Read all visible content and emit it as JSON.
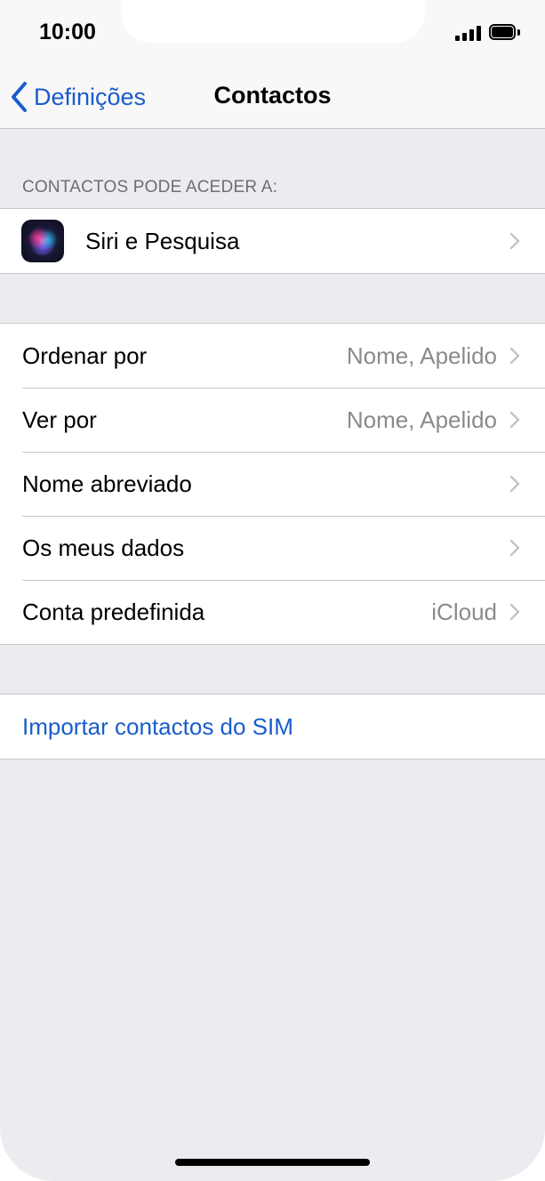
{
  "status_bar": {
    "time": "10:00"
  },
  "nav": {
    "back_label": "Definições",
    "title": "Contactos"
  },
  "section_access": {
    "header": "CONTACTOS PODE ACEDER A:",
    "items": [
      {
        "label": "Siri e Pesquisa",
        "icon": "siri-icon"
      }
    ]
  },
  "settings": {
    "items": [
      {
        "label": "Ordenar por",
        "value": "Nome, Apelido"
      },
      {
        "label": "Ver por",
        "value": "Nome, Apelido"
      },
      {
        "label": "Nome abreviado",
        "value": ""
      },
      {
        "label": "Os meus dados",
        "value": ""
      },
      {
        "label": "Conta predefinida",
        "value": "iCloud"
      }
    ]
  },
  "import": {
    "label": "Importar contactos do SIM"
  },
  "colors": {
    "accent": "#1a5ccc",
    "background": "#ebebf0",
    "secondary_text": "#8a8a8f"
  }
}
